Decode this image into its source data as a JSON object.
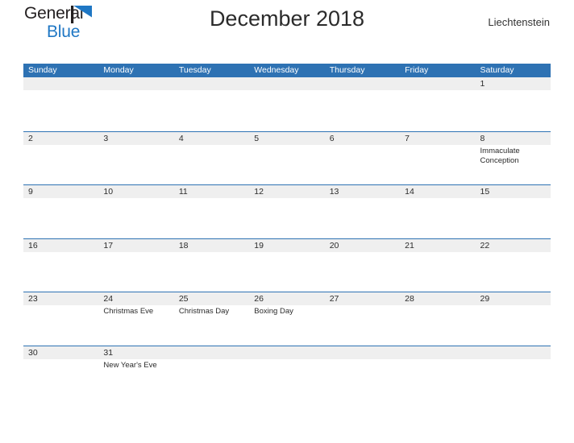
{
  "brand": {
    "word1": "General",
    "word2": "Blue",
    "flag_icon": "blue-triangle-flag-icon",
    "accent_color": "#1f77c4"
  },
  "header": {
    "title": "December 2018",
    "country": "Liechtenstein"
  },
  "calendar": {
    "header_bg": "#2e72b3",
    "band_bg": "#efefef",
    "rule_color": "#2e72b3",
    "weekdays": [
      "Sunday",
      "Monday",
      "Tuesday",
      "Wednesday",
      "Thursday",
      "Friday",
      "Saturday"
    ],
    "weeks": [
      {
        "days": [
          {
            "num": "",
            "event": ""
          },
          {
            "num": "",
            "event": ""
          },
          {
            "num": "",
            "event": ""
          },
          {
            "num": "",
            "event": ""
          },
          {
            "num": "",
            "event": ""
          },
          {
            "num": "",
            "event": ""
          },
          {
            "num": "1",
            "event": ""
          }
        ]
      },
      {
        "days": [
          {
            "num": "2",
            "event": ""
          },
          {
            "num": "3",
            "event": ""
          },
          {
            "num": "4",
            "event": ""
          },
          {
            "num": "5",
            "event": ""
          },
          {
            "num": "6",
            "event": ""
          },
          {
            "num": "7",
            "event": ""
          },
          {
            "num": "8",
            "event": "Immaculate Conception"
          }
        ]
      },
      {
        "days": [
          {
            "num": "9",
            "event": ""
          },
          {
            "num": "10",
            "event": ""
          },
          {
            "num": "11",
            "event": ""
          },
          {
            "num": "12",
            "event": ""
          },
          {
            "num": "13",
            "event": ""
          },
          {
            "num": "14",
            "event": ""
          },
          {
            "num": "15",
            "event": ""
          }
        ]
      },
      {
        "days": [
          {
            "num": "16",
            "event": ""
          },
          {
            "num": "17",
            "event": ""
          },
          {
            "num": "18",
            "event": ""
          },
          {
            "num": "19",
            "event": ""
          },
          {
            "num": "20",
            "event": ""
          },
          {
            "num": "21",
            "event": ""
          },
          {
            "num": "22",
            "event": ""
          }
        ]
      },
      {
        "days": [
          {
            "num": "23",
            "event": ""
          },
          {
            "num": "24",
            "event": "Christmas Eve"
          },
          {
            "num": "25",
            "event": "Christmas Day"
          },
          {
            "num": "26",
            "event": "Boxing Day"
          },
          {
            "num": "27",
            "event": ""
          },
          {
            "num": "28",
            "event": ""
          },
          {
            "num": "29",
            "event": ""
          }
        ]
      },
      {
        "days": [
          {
            "num": "30",
            "event": ""
          },
          {
            "num": "31",
            "event": "New Year's Eve"
          },
          {
            "num": "",
            "event": ""
          },
          {
            "num": "",
            "event": ""
          },
          {
            "num": "",
            "event": ""
          },
          {
            "num": "",
            "event": ""
          },
          {
            "num": "",
            "event": ""
          }
        ]
      }
    ]
  }
}
